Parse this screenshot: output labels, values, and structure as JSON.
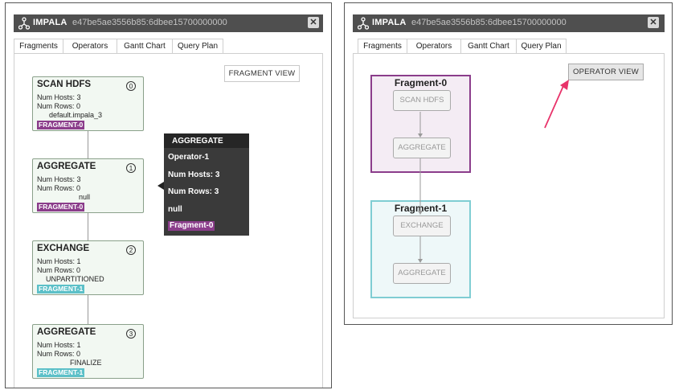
{
  "left_panel": {
    "app_name": "IMPALA",
    "app_id": "e47be5ae3556b85:6dbee15700000000",
    "close_glyph": "✕",
    "tabs": [
      "Fragments",
      "Operators",
      "Gantt Chart",
      "Query Plan"
    ],
    "active_tab": "Query Plan",
    "view_button": "FRAGMENT VIEW",
    "nodes": [
      {
        "title": "SCAN HDFS",
        "num": "0",
        "hosts": "Num Hosts: 3",
        "rows": "Num Rows: 0",
        "detail": "default.impala_3",
        "fragment": "FRAGMENT-0"
      },
      {
        "title": "AGGREGATE",
        "num": "1",
        "hosts": "Num Hosts: 3",
        "rows": "Num Rows: 0",
        "detail": "null",
        "fragment": "FRAGMENT-0"
      },
      {
        "title": "EXCHANGE",
        "num": "2",
        "hosts": "Num Hosts: 1",
        "rows": "Num Rows: 0",
        "detail": "UNPARTITIONED",
        "fragment": "FRAGMENT-1"
      },
      {
        "title": "AGGREGATE",
        "num": "3",
        "hosts": "Num Hosts: 1",
        "rows": "Num Rows: 0",
        "detail": "FINALIZE",
        "fragment": "FRAGMENT-1"
      }
    ],
    "tooltip": {
      "title": "AGGREGATE",
      "operator": "Operator-1",
      "hosts": "Num Hosts: 3",
      "rows": "Num Rows: 3",
      "detail": "null",
      "fragment": "Fragment-0"
    }
  },
  "right_panel": {
    "app_name": "IMPALA",
    "app_id": "e47be5ae3556b85:6dbee15700000000",
    "close_glyph": "✕",
    "tabs": [
      "Fragments",
      "Operators",
      "Gantt Chart",
      "Query Plan"
    ],
    "active_tab": "Query Plan",
    "view_button": "OPERATOR VIEW",
    "fragments": [
      {
        "label": "Fragment-0",
        "operators": [
          "SCAN HDFS",
          "AGGREGATE"
        ]
      },
      {
        "label": "Fragment-1",
        "operators": [
          "EXCHANGE",
          "AGGREGATE"
        ]
      }
    ]
  },
  "colors": {
    "title_bar": "#4f4f4f",
    "fragment_0": "#8b3d8b",
    "fragment_1": "#5cc0c8",
    "node_fill": "#f2f8f2",
    "annotation_arrow": "#e8336a"
  },
  "icons": {
    "app": "network-node-icon",
    "close": "close-icon"
  }
}
